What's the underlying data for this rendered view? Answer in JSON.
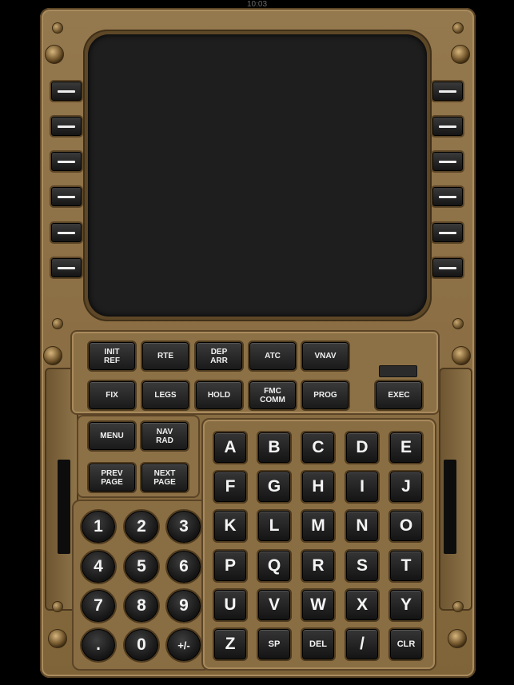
{
  "status": {
    "time": "10:03"
  },
  "fmc": {
    "function_keys": [
      {
        "id": "init-ref",
        "label": "INIT\nREF"
      },
      {
        "id": "rte",
        "label": "RTE"
      },
      {
        "id": "dep-arr",
        "label": "DEP\nARR"
      },
      {
        "id": "atc",
        "label": "ATC"
      },
      {
        "id": "vnav",
        "label": "VNAV"
      },
      {
        "id": "fix",
        "label": "FIX"
      },
      {
        "id": "legs",
        "label": "LEGS"
      },
      {
        "id": "hold",
        "label": "HOLD"
      },
      {
        "id": "fmc-comm",
        "label": "FMC\nCOMM"
      },
      {
        "id": "prog",
        "label": "PROG"
      },
      {
        "id": "exec",
        "label": "EXEC"
      },
      {
        "id": "menu",
        "label": "MENU"
      },
      {
        "id": "nav-rad",
        "label": "NAV\nRAD"
      },
      {
        "id": "prev-page",
        "label": "PREV\nPAGE"
      },
      {
        "id": "next-page",
        "label": "NEXT\nPAGE"
      }
    ],
    "alpha_keys": [
      "A",
      "B",
      "C",
      "D",
      "E",
      "F",
      "G",
      "H",
      "I",
      "J",
      "K",
      "L",
      "M",
      "N",
      "O",
      "P",
      "Q",
      "R",
      "S",
      "T",
      "U",
      "V",
      "W",
      "X",
      "Y",
      "Z",
      "SP",
      "DEL",
      "/",
      "CLR"
    ],
    "numeric_keys": [
      "1",
      "2",
      "3",
      "4",
      "5",
      "6",
      "7",
      "8",
      "9",
      ".",
      "0",
      "+/-"
    ]
  }
}
